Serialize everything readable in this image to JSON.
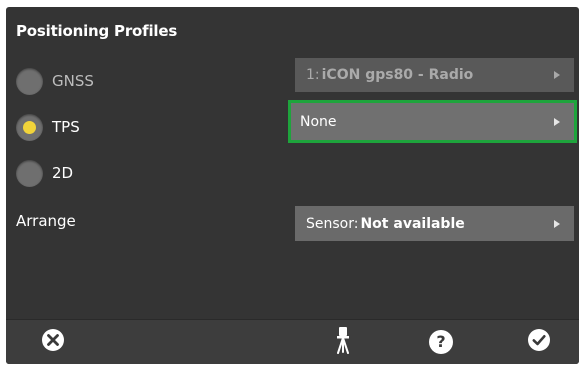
{
  "panel": {
    "title": "Positioning Profiles"
  },
  "profiles": [
    {
      "label": "GNSS",
      "selected": false
    },
    {
      "label": "TPS",
      "selected": true
    },
    {
      "label": "2D",
      "selected": false
    }
  ],
  "selects": {
    "gnss": {
      "prefix": "1:",
      "value": "iCON gps80 - Radio",
      "enabled": false
    },
    "tps": {
      "value": "None",
      "enabled": true,
      "highlighted": true
    },
    "arrange": {
      "prefix": "Sensor:",
      "value": "Not available"
    }
  },
  "arrange": {
    "label": "Arrange"
  },
  "toolbar": {
    "cancel_icon": "close-circle-icon",
    "instrument_icon": "tripod-instrument-icon",
    "help_icon": "help-circle-icon",
    "help_glyph": "?",
    "confirm_icon": "check-circle-icon"
  },
  "colors": {
    "background": "#343434",
    "highlight_border": "#1ea43c",
    "radio_selected_dot": "#f2d43a"
  }
}
